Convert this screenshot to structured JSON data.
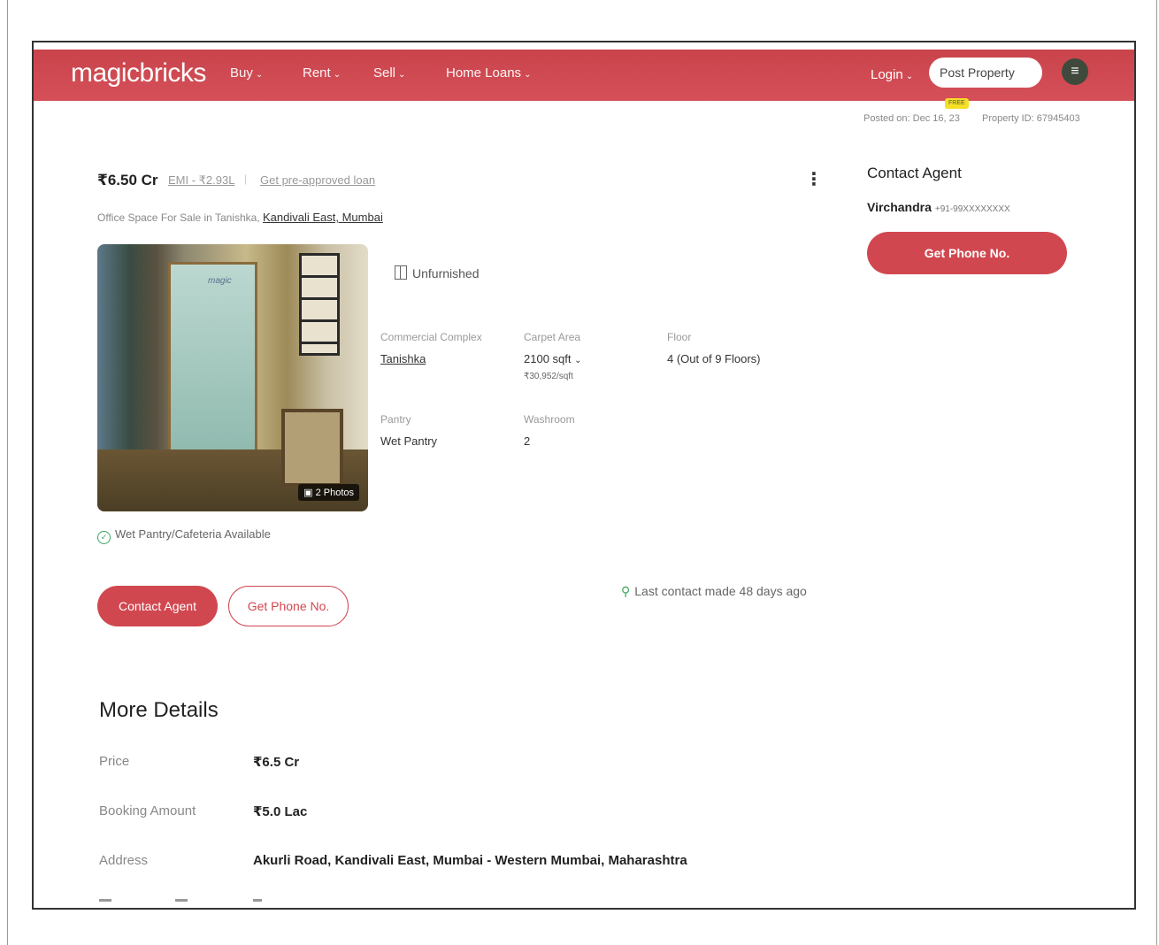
{
  "header": {
    "logo": "magicbricks",
    "nav": [
      {
        "label": "Buy"
      },
      {
        "label": "Rent"
      },
      {
        "label": "Sell"
      },
      {
        "label": "Home Loans"
      }
    ],
    "login": "Login",
    "post_property": "Post Property",
    "free_badge": "FREE",
    "brand_color": "#d1474f"
  },
  "meta": {
    "posted_on": "Posted on: Dec 16, 23",
    "property_id": "Property ID: 67945403"
  },
  "listing": {
    "price": "₹6.50 Cr",
    "emi": "EMI - ₹2.93L",
    "separator": "|",
    "loan_link": "Get pre-approved loan",
    "subtitle_prefix": "Office Space For Sale in Tanishka,",
    "location": "Kandivali East, Mumbai",
    "photo_brand": "magic",
    "photo_count": "2 Photos",
    "furnishing": "Unfurnished",
    "specs": {
      "complex_label": "Commercial Complex",
      "complex_value": "Tanishka",
      "carpet_label": "Carpet Area",
      "carpet_value": "2100 sqft",
      "carpet_sub": "₹30,952/sqft",
      "floor_label": "Floor",
      "floor_value": "4 (Out of 9 Floors)",
      "pantry_label": "Pantry",
      "pantry_value": "Wet Pantry",
      "washroom_label": "Washroom",
      "washroom_value": "2"
    },
    "amenity": "Wet Pantry/Cafeteria Available",
    "contact_agent_btn": "Contact Agent",
    "get_phone_btn": "Get Phone No.",
    "last_contact": "Last contact made 48 days ago"
  },
  "agent_panel": {
    "title": "Contact Agent",
    "name": "Virchandra",
    "phone": "+91-99XXXXXXXX",
    "button": "Get Phone No."
  },
  "more_details": {
    "title": "More Details",
    "rows": [
      {
        "label": "Price",
        "value": "₹6.5 Cr"
      },
      {
        "label": "Booking Amount",
        "value": "₹5.0 Lac"
      },
      {
        "label": "Address",
        "value": "Akurli Road, Kandivali East, Mumbai - Western Mumbai, Maharashtra"
      }
    ]
  }
}
